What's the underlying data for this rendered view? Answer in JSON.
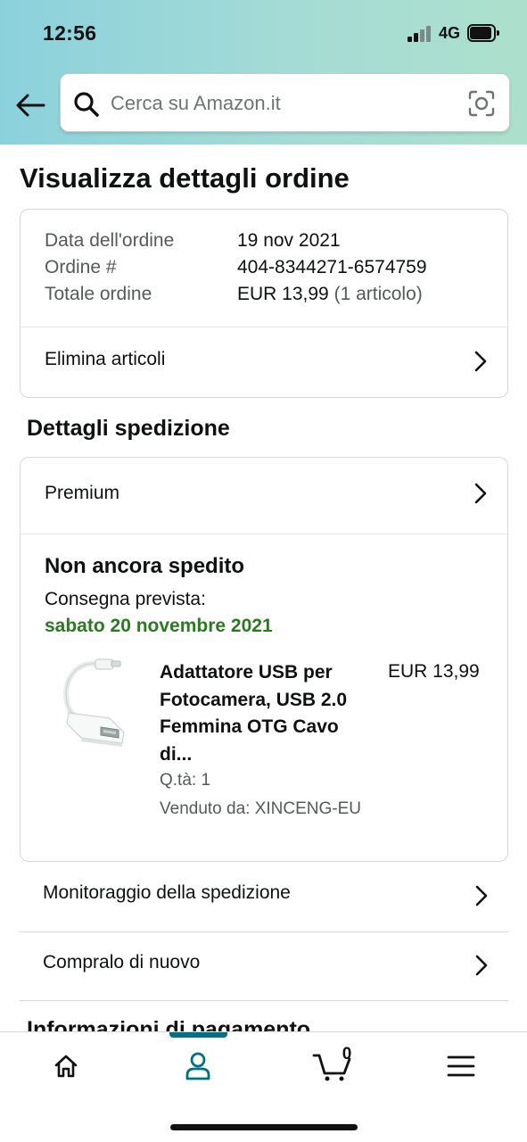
{
  "status_bar": {
    "time": "12:56",
    "network": "4G"
  },
  "search": {
    "placeholder": "Cerca su Amazon.it"
  },
  "page": {
    "title": "Visualizza dettagli ordine"
  },
  "order": {
    "date_label": "Data dell'ordine",
    "date_value": "19 nov 2021",
    "number_label": "Ordine #",
    "number_value": "404-8344271-6574759",
    "total_label": "Totale ordine",
    "total_value": "EUR 13,99",
    "total_items": "(1 articolo)",
    "delete_items_label": "Elimina articoli"
  },
  "shipping": {
    "section_title": "Dettagli spedizione",
    "shipping_type": "Premium",
    "status": "Non ancora spedito",
    "delivery_label": "Consegna prevista:",
    "delivery_date": "sabato 20 novembre 2021",
    "delivery_date_color": "#2a7a1f",
    "product": {
      "title": "Adattatore USB per Fotocamera, USB 2.0 Femmina OTG Cavo di...",
      "price": "EUR 13,99",
      "quantity": "Q.tà: 1",
      "seller": "Venduto da: XINCENG-EU"
    }
  },
  "actions": {
    "track": "Monitoraggio della spedizione",
    "buy_again": "Compralo di nuovo"
  },
  "payment": {
    "section_title": "Informazioni di pagamento"
  },
  "bottom_nav": {
    "cart_count": "0",
    "active_color": "#007185",
    "icons": [
      "home-icon",
      "account-icon",
      "cart-icon",
      "menu-icon"
    ]
  },
  "accent_colors": {
    "header_gradient": [
      "#8bd1dc",
      "#ade0cc"
    ],
    "link_teal": "#007185"
  }
}
